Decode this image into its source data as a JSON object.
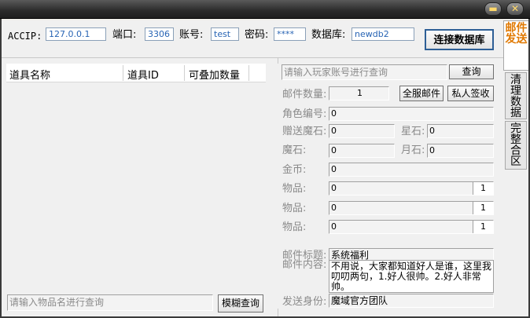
{
  "titlebar": {
    "min_icon": "minimize-icon",
    "close_icon": "close-icon"
  },
  "connection": {
    "accip_label": "ACCIP:",
    "accip_value": "127.0.0.1",
    "port_label": "端口:",
    "port_value": "3306",
    "account_label": "账号:",
    "account_value": "test",
    "password_label": "密码:",
    "password_value": "****",
    "db_label": "数据库:",
    "db_value": "newdb2",
    "connect_button": "连接数据库"
  },
  "item_table": {
    "columns": [
      "道具名称",
      "道具ID",
      "可叠加数量"
    ],
    "search_placeholder": "请输入物品名进行查询",
    "search_button": "模糊查询"
  },
  "mail": {
    "player_search_placeholder": "请输入玩家账号进行查询",
    "query_button": "查询",
    "mail_count_label": "邮件数量:",
    "mail_count_value": "1",
    "all_server_button": "全服邮件",
    "private_button": "私人签收",
    "role_id_label": "角色编号:",
    "role_id_value": "0",
    "gift_magic_label": "赠送魔石:",
    "gift_magic_value": "0",
    "star_stone_label": "星石:",
    "star_stone_value": "0",
    "magic_stone_label": "魔石:",
    "magic_stone_value": "0",
    "moon_stone_label": "月石:",
    "moon_stone_value": "0",
    "gold_label": "金币:",
    "gold_value": "0",
    "items": [
      {
        "label": "物品:",
        "value": "0",
        "qty": "1"
      },
      {
        "label": "物品:",
        "value": "0",
        "qty": "1"
      },
      {
        "label": "物品:",
        "value": "0",
        "qty": "1"
      }
    ],
    "title_label": "邮件标题:",
    "title_value": "系统福利",
    "content_label": "邮件内容:",
    "content_value": "不用说，大家都知道好人是谁，这里我叨叨两句，1.好人很帅。2.好人非常帅。",
    "sender_label": "发送身份:",
    "sender_value": "魔域官方团队"
  },
  "tabs": [
    {
      "label": "邮件发送",
      "active": true
    },
    {
      "label": "清理数据",
      "active": false
    },
    {
      "label": "完整合区",
      "active": false
    }
  ]
}
